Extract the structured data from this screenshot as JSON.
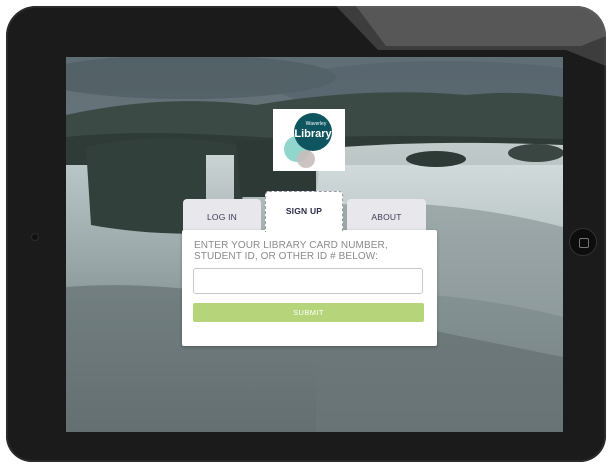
{
  "logo": {
    "line1": "Waverley",
    "line2": "Library",
    "colors": {
      "teal": "#0e5560",
      "mint": "#7ccfc3",
      "grey": "#c8bcbc"
    }
  },
  "tabs": [
    {
      "label": "LOG IN"
    },
    {
      "label": "SIGN UP"
    },
    {
      "label": "ABOUT"
    }
  ],
  "form": {
    "prompt_line1": "ENTER YOUR LIBRARY CARD NUMBER,",
    "prompt_line2": "STUDENT ID, OR OTHER ID # BELOW:",
    "input_value": "",
    "submit_label": "SUBMIT"
  },
  "colors": {
    "submit_button": "#b6d57a",
    "device_frame": "#1b1b1b"
  },
  "background_image": "waterfall-landscape"
}
